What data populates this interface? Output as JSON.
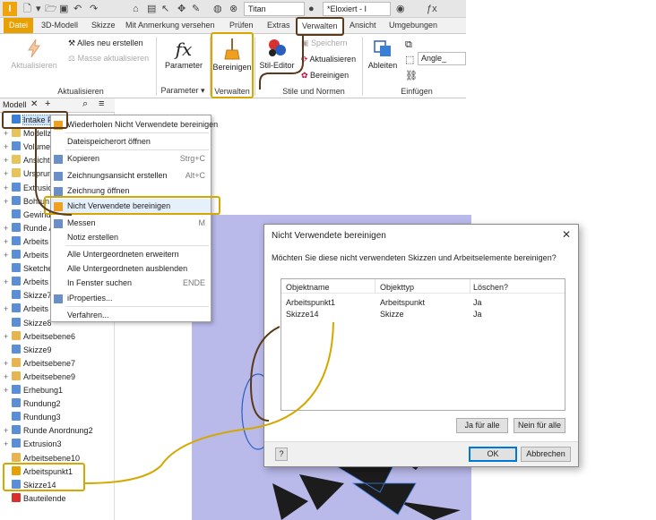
{
  "titlebar": {
    "app_letter": "I",
    "material": "Titan",
    "appearance": "*Eloxiert - I"
  },
  "tabs": [
    "Datei",
    "3D-Modell",
    "Skizze",
    "Mit Anmerkung versehen",
    "Prüfen",
    "Extras",
    "Verwalten",
    "Ansicht",
    "Umgebungen"
  ],
  "active_tab": "Verwalten",
  "ribbon": {
    "aktualisieren": {
      "big_button": "Aktualisieren",
      "rebuild_all": "Alles neu erstellen",
      "mass_update": "Masse aktualisieren",
      "group_label": "Aktualisieren"
    },
    "parameter": {
      "big_button": "Parameter",
      "icon_text": "fx",
      "group_label": "Parameter"
    },
    "verwalten": {
      "big_button": "Bereinigen",
      "group_label": "Verwalten"
    },
    "stile": {
      "big_button": "Stil-Editor",
      "save": "Speichern",
      "update": "Aktualisieren",
      "purge": "Bereinigen",
      "group_label": "Stile und Normen"
    },
    "einfuegen": {
      "big_button": "Ableiten",
      "field": "Angle_",
      "group_label": "Einfügen"
    }
  },
  "panel": {
    "tab_label": "Modell",
    "tree": [
      {
        "label": "Intake Fan",
        "icon": "part-icon",
        "color": "#3a7fd6",
        "selected": true
      },
      {
        "label": "Modellz",
        "icon": "folder-icon",
        "color": "#e8c25a",
        "plus": true
      },
      {
        "label": "Volumen",
        "icon": "solid-icon",
        "color": "#5a8fd8",
        "plus": true
      },
      {
        "label": "Ansicht",
        "icon": "folder-icon",
        "color": "#e8c25a",
        "plus": true
      },
      {
        "label": "Ursprun",
        "icon": "folder-icon",
        "color": "#e8c25a",
        "plus": true
      },
      {
        "label": "Extrusio",
        "icon": "extrude-icon",
        "color": "#5a8fd8",
        "plus": true
      },
      {
        "label": "Bohrun",
        "icon": "hole-icon",
        "color": "#5a8fd8",
        "plus": true
      },
      {
        "label": "Gewind",
        "icon": "thread-icon",
        "color": "#5a8fd8",
        "plus": false
      },
      {
        "label": "Runde A",
        "icon": "pattern-icon",
        "color": "#5a8fd8",
        "plus": true
      },
      {
        "label": "Arbeits",
        "icon": "pattern-icon",
        "color": "#5a8fd8",
        "plus": true
      },
      {
        "label": "Arbeits",
        "icon": "pattern-icon",
        "color": "#5a8fd8",
        "plus": true
      },
      {
        "label": "Sketche",
        "icon": "sketch-icon",
        "color": "#5a8fd8",
        "plus": false
      },
      {
        "label": "Arbeits",
        "icon": "pattern-icon",
        "color": "#5a8fd8",
        "plus": true
      },
      {
        "label": "Skizze7",
        "icon": "sketch-icon",
        "color": "#5a8fd8",
        "plus": false
      },
      {
        "label": "Arbeits",
        "icon": "pattern-icon",
        "color": "#5a8fd8",
        "plus": true
      },
      {
        "label": "Skizze8",
        "icon": "sketch-icon",
        "color": "#5a8fd8",
        "plus": false
      },
      {
        "label": "Arbeitsebene6",
        "icon": "plane-icon",
        "color": "#e8b450",
        "plus": true
      },
      {
        "label": "Skizze9",
        "icon": "sketch-icon",
        "color": "#5a8fd8",
        "plus": false
      },
      {
        "label": "Arbeitsebene7",
        "icon": "plane-icon",
        "color": "#e8b450",
        "plus": true
      },
      {
        "label": "Arbeitsebene9",
        "icon": "plane-icon",
        "color": "#e8b450",
        "plus": true
      },
      {
        "label": "Erhebung1",
        "icon": "loft-icon",
        "color": "#5a8fd8",
        "plus": true
      },
      {
        "label": "Rundung2",
        "icon": "fillet-icon",
        "color": "#5a8fd8",
        "plus": false
      },
      {
        "label": "Rundung3",
        "icon": "fillet-icon",
        "color": "#5a8fd8",
        "plus": false
      },
      {
        "label": "Runde Anordnung2",
        "icon": "pattern-icon",
        "color": "#5a8fd8",
        "plus": true
      },
      {
        "label": "Extrusion3",
        "icon": "extrude-icon",
        "color": "#5a8fd8",
        "plus": true
      },
      {
        "label": "Arbeitsebene10",
        "icon": "plane-icon",
        "color": "#e8b450",
        "plus": false
      },
      {
        "label": "Arbeitspunkt1",
        "icon": "workpoint-icon",
        "color": "#e8a000",
        "plus": false
      },
      {
        "label": "Skizze14",
        "icon": "sketch-icon",
        "color": "#5a8fd8",
        "plus": false
      },
      {
        "label": "Bauteilende",
        "icon": "end-of-part-icon",
        "color": "#d9302c",
        "plus": false
      }
    ]
  },
  "menu": {
    "items": [
      {
        "label": "Wiederholen Nicht Verwendete bereinigen",
        "shortcut": "",
        "icon": "brush-icon"
      },
      {
        "label": "Dateispeicherort öffnen",
        "shortcut": "",
        "icon": ""
      },
      {
        "label": "Kopieren",
        "shortcut": "Strg+C",
        "icon": "copy-icon"
      },
      {
        "label": "Zeichnungsansicht erstellen",
        "shortcut": "Alt+C",
        "icon": "drawing-view-icon"
      },
      {
        "label": "Zeichnung öffnen",
        "shortcut": "",
        "icon": "open-drawing-icon"
      },
      {
        "label": "Nicht Verwendete bereinigen",
        "shortcut": "",
        "icon": "brush-icon"
      },
      {
        "label": "Messen",
        "shortcut": "M",
        "icon": "measure-icon"
      },
      {
        "label": "Notiz erstellen",
        "shortcut": "",
        "icon": ""
      },
      {
        "label": "Alle Untergeordneten erweitern",
        "shortcut": "",
        "icon": ""
      },
      {
        "label": "Alle Untergeordneten ausblenden",
        "shortcut": "",
        "icon": ""
      },
      {
        "label": "In Fenster suchen",
        "shortcut": "ENDE",
        "icon": ""
      },
      {
        "label": "iProperties...",
        "shortcut": "",
        "icon": "iproperties-icon"
      },
      {
        "label": "Verfahren...",
        "shortcut": "",
        "icon": ""
      }
    ]
  },
  "dialog": {
    "title": "Nicht Verwendete bereinigen",
    "message": "Möchten Sie diese nicht verwendeten Skizzen und Arbeitselemente bereinigen?",
    "columns": [
      "Objektname",
      "Objekttyp",
      "Löschen?"
    ],
    "rows": [
      [
        "Arbeitspunkt1",
        "Arbeitspunkt",
        "Ja"
      ],
      [
        "Skizze14",
        "Skizze",
        "Ja"
      ]
    ],
    "yes_all": "Ja für alle",
    "no_all": "Nein für alle",
    "ok": "OK",
    "cancel": "Abbrechen",
    "help": "?"
  },
  "colors": {
    "highlight": "#d4a800",
    "dark_highlight": "#5a3a1a",
    "viewport": "#b9b9ea",
    "file_tab": "#e8a000"
  }
}
